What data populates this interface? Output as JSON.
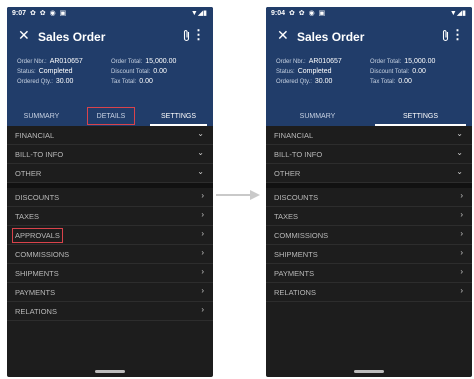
{
  "left": {
    "time": "9:07",
    "status_icons": "✿ ✿ ◉ ▣",
    "status_right": "▼◢▮",
    "title": "Sales Order",
    "info": {
      "order_nbr_label": "Order Nbr.:",
      "order_nbr": "AR010657",
      "status_label": "Status:",
      "status": "Completed",
      "ordered_qty_label": "Ordered Qty.:",
      "ordered_qty": "30.00",
      "order_total_label": "Order Total:",
      "order_total": "15,000.00",
      "discount_total_label": "Discount Total:",
      "discount_total": "0.00",
      "tax_total_label": "Tax Total:",
      "tax_total": "0.00"
    },
    "tabs": [
      "SUMMARY",
      "DETAILS",
      "SETTINGS"
    ],
    "group1": [
      "FINANCIAL",
      "BILL-TO INFO",
      "OTHER"
    ],
    "group2": [
      "DISCOUNTS",
      "TAXES",
      "APPROVALS",
      "COMMISSIONS",
      "SHIPMENTS",
      "PAYMENTS",
      "RELATIONS"
    ]
  },
  "right": {
    "time": "9:04",
    "status_icons": "✿ ✿ ◉ ▣",
    "status_right": "▼◢▮",
    "title": "Sales Order",
    "info": {
      "order_nbr_label": "Order Nbr.:",
      "order_nbr": "AR010657",
      "status_label": "Status:",
      "status": "Completed",
      "ordered_qty_label": "Ordered Qty.:",
      "ordered_qty": "30.00",
      "order_total_label": "Order Total:",
      "order_total": "15,000.00",
      "discount_total_label": "Discount Total:",
      "discount_total": "0.00",
      "tax_total_label": "Tax Total:",
      "tax_total": "0.00"
    },
    "tabs": [
      "SUMMARY",
      "SETTINGS"
    ],
    "group1": [
      "FINANCIAL",
      "BILL-TO INFO",
      "OTHER"
    ],
    "group2": [
      "DISCOUNTS",
      "TAXES",
      "COMMISSIONS",
      "SHIPMENTS",
      "PAYMENTS",
      "RELATIONS"
    ]
  },
  "icons": {
    "close": "close-icon",
    "attach": "paperclip-icon",
    "more": "more-vert-icon",
    "expand": "chevron-down-icon",
    "forward": "chevron-right-icon"
  },
  "colors": {
    "app_bar": "#213d6a",
    "list_bg": "#1d1d1d",
    "highlight": "#d9434b"
  }
}
